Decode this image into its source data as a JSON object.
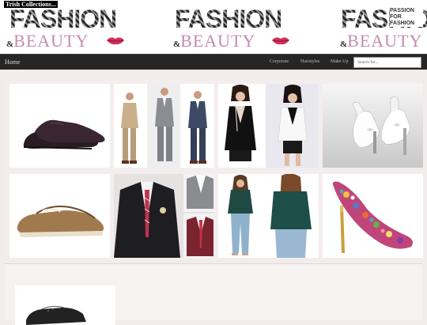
{
  "banner": {
    "site_title": "Trish Collections...",
    "word_fashion": "FASHION",
    "word_beauty": "BEAUTY",
    "amp": "&",
    "badge": "PASSION FOR FASHION"
  },
  "nav": {
    "home": "Home",
    "items": [
      "Corporate",
      "Hairstyles",
      "Make Up"
    ],
    "search_placeholder": "Search for..."
  },
  "products": [
    "oxford-shoes-photo",
    "men-suits-photo",
    "women-blazers-photo",
    "white-heels-photo",
    "boat-shoes-photo",
    "men-jackets-photo",
    "green-blouse-outfit-photo",
    "floral-heels-photo"
  ],
  "colors": {
    "nav_bg": "#262626",
    "page_bg": "#f2ecec",
    "accent_pink": "#c48bb1"
  }
}
